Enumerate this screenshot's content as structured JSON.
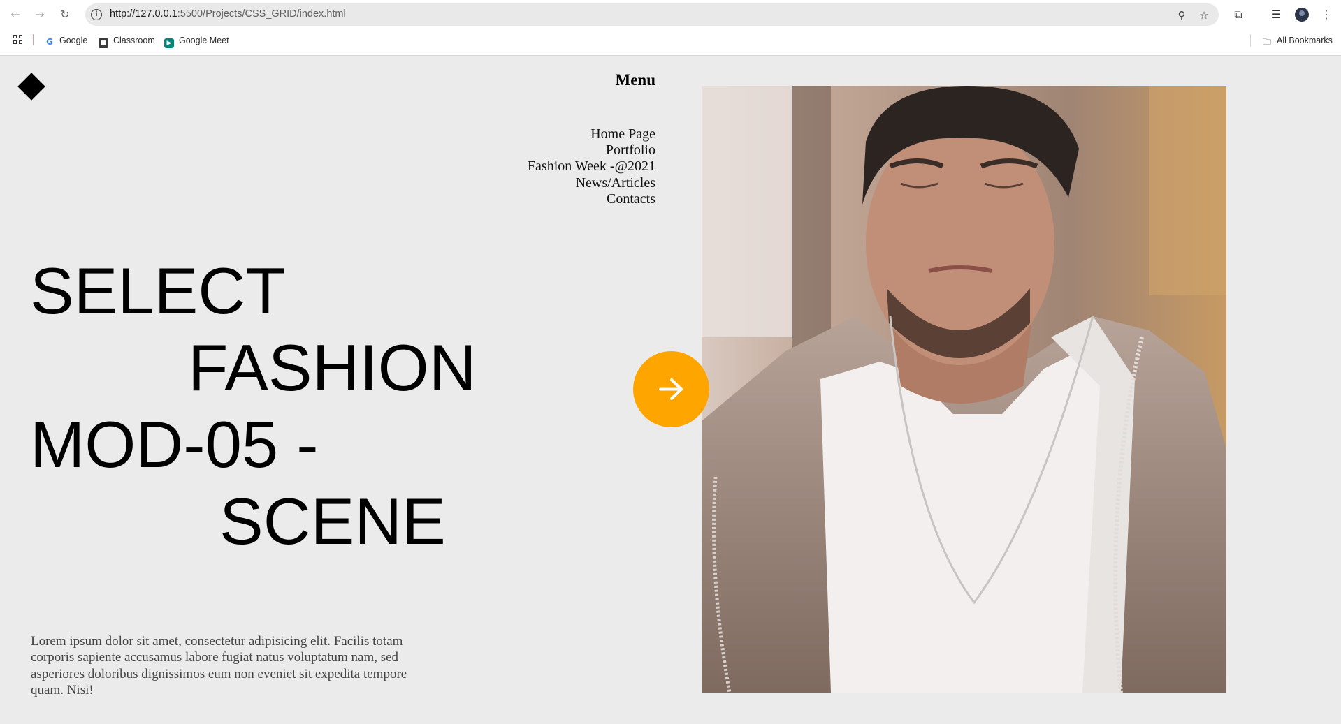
{
  "browser": {
    "url_host": "http://127.0.0.1",
    "url_path": ":5500/Projects/CSS_GRID/index.html",
    "bookmarks": [
      {
        "label": "Google",
        "icon": "google-icon"
      },
      {
        "label": "Classroom",
        "icon": "classroom-icon"
      },
      {
        "label": "Google Meet",
        "icon": "google-meet-icon"
      }
    ],
    "all_bookmarks": "All Bookmarks"
  },
  "page": {
    "menu_title": "Menu",
    "menu_items": [
      "Home Page",
      "Portfolio",
      "Fashion Week -@2021",
      "News/Articles",
      "Contacts"
    ],
    "hero_lines": [
      "SELECT",
      "FASHION",
      "MOD-05 -",
      "SCENE"
    ],
    "description": "Lorem ipsum dolor sit amet, consectetur adipisicing elit. Facilis totam corporis sapiente accusamus labore fugiat natus voluptatum nam, sed asperiores doloribus dignissimos eum non eveniet sit expedita tempore quam. Nisi!",
    "accent_color": "#ffa500",
    "background_color": "#ebebeb"
  }
}
